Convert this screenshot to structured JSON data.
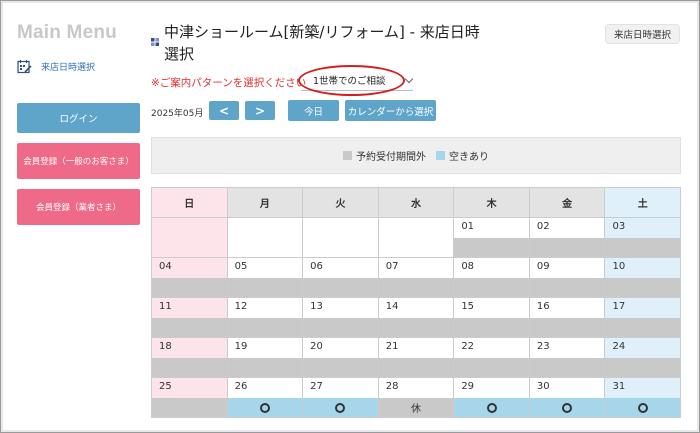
{
  "sidebar": {
    "title": "Main Menu",
    "link_label": "来店日時選択",
    "login_label": "ログイン",
    "member_general_label": "会員登録（一般のお客さま）",
    "member_trade_label": "会員登録（業者さま）"
  },
  "header": {
    "title": "中津ショールーム[新築/リフォーム] - 来店日時選択",
    "top_tag": "来店日時選択",
    "pattern_prompt": "※ご案内パターンを選択ください",
    "pattern_selected": "1世帯でのご相談"
  },
  "nav": {
    "month": "2025年05月",
    "prev_symbol": "<",
    "next_symbol": ">",
    "today_label": "今日",
    "calendar_label": "カレンダーから選択"
  },
  "legend": {
    "unavailable_label": "予約受付期間外",
    "available_label": "空きあり",
    "unavailable_color": "#c9c9c9",
    "available_color": "#a5d6ea"
  },
  "colors": {
    "accent": "#5fa4c9",
    "pink": "#ee6a88",
    "sunday_bg": "#fde3ea",
    "saturday_bg": "#dff0fa"
  },
  "calendar": {
    "weekdays": [
      "日",
      "月",
      "火",
      "水",
      "木",
      "金",
      "土"
    ],
    "weeks": [
      [
        {
          "day": "",
          "status": "empty"
        },
        {
          "day": "",
          "status": "empty"
        },
        {
          "day": "",
          "status": "empty"
        },
        {
          "day": "",
          "status": "empty"
        },
        {
          "day": "01",
          "status": "unavailable"
        },
        {
          "day": "02",
          "status": "unavailable"
        },
        {
          "day": "03",
          "status": "unavailable"
        }
      ],
      [
        {
          "day": "04",
          "status": "unavailable"
        },
        {
          "day": "05",
          "status": "unavailable"
        },
        {
          "day": "06",
          "status": "unavailable"
        },
        {
          "day": "07",
          "status": "unavailable"
        },
        {
          "day": "08",
          "status": "unavailable"
        },
        {
          "day": "09",
          "status": "unavailable"
        },
        {
          "day": "10",
          "status": "unavailable"
        }
      ],
      [
        {
          "day": "11",
          "status": "unavailable"
        },
        {
          "day": "12",
          "status": "unavailable"
        },
        {
          "day": "13",
          "status": "unavailable"
        },
        {
          "day": "14",
          "status": "unavailable"
        },
        {
          "day": "15",
          "status": "unavailable"
        },
        {
          "day": "16",
          "status": "unavailable"
        },
        {
          "day": "17",
          "status": "unavailable"
        }
      ],
      [
        {
          "day": "18",
          "status": "unavailable"
        },
        {
          "day": "19",
          "status": "unavailable"
        },
        {
          "day": "20",
          "status": "unavailable"
        },
        {
          "day": "21",
          "status": "unavailable"
        },
        {
          "day": "22",
          "status": "unavailable"
        },
        {
          "day": "23",
          "status": "unavailable"
        },
        {
          "day": "24",
          "status": "unavailable"
        }
      ],
      [
        {
          "day": "25",
          "status": "unavailable"
        },
        {
          "day": "26",
          "status": "available",
          "mark": "circle"
        },
        {
          "day": "27",
          "status": "available",
          "mark": "circle"
        },
        {
          "day": "28",
          "status": "closed",
          "mark_text": "休"
        },
        {
          "day": "29",
          "status": "available",
          "mark": "circle"
        },
        {
          "day": "30",
          "status": "available",
          "mark": "circle"
        },
        {
          "day": "31",
          "status": "available",
          "mark": "circle"
        }
      ]
    ]
  }
}
